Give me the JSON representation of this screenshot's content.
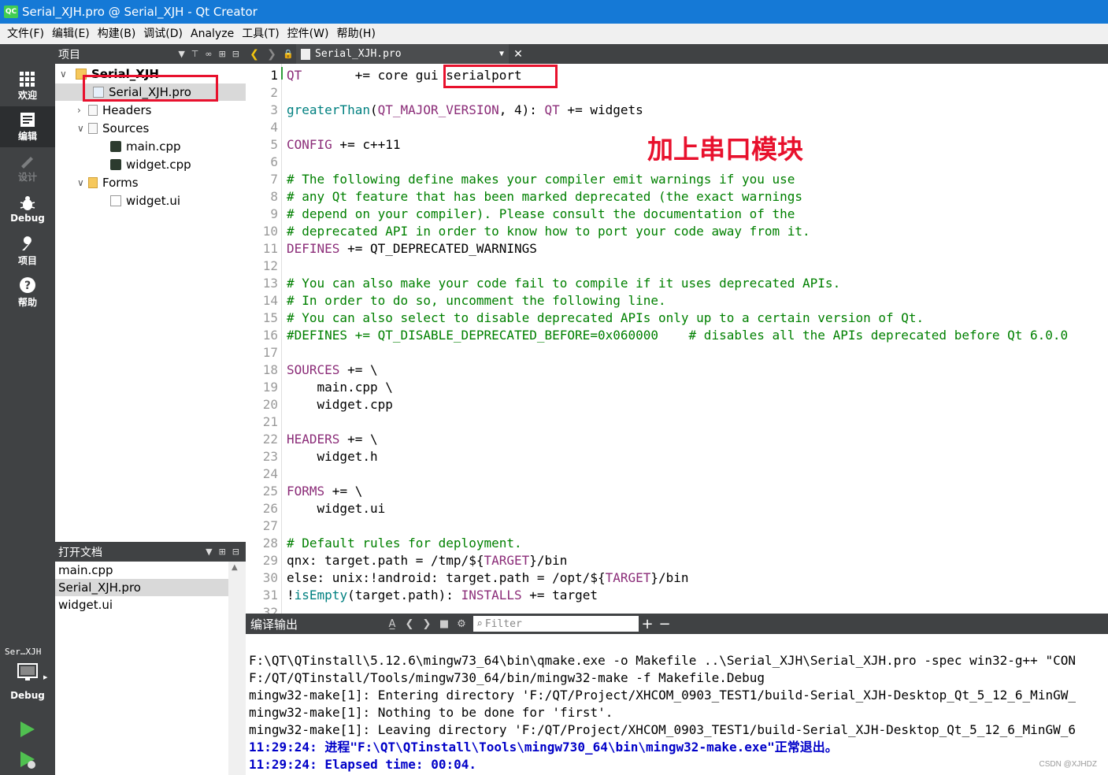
{
  "window": {
    "title": "Serial_XJH.pro @ Serial_XJH - Qt Creator",
    "logo_text": "QC"
  },
  "menubar": [
    "文件(F)",
    "编辑(E)",
    "构建(B)",
    "调试(D)",
    "Analyze",
    "工具(T)",
    "控件(W)",
    "帮助(H)"
  ],
  "modes": [
    {
      "label": "欢迎",
      "icon": "grid-icon",
      "state": "normal"
    },
    {
      "label": "编辑",
      "icon": "edit-icon",
      "state": "active"
    },
    {
      "label": "设计",
      "icon": "pen-icon",
      "state": "disabled"
    },
    {
      "label": "Debug",
      "icon": "bug-icon",
      "state": "normal"
    },
    {
      "label": "项目",
      "icon": "wrench-icon",
      "state": "normal"
    },
    {
      "label": "帮助",
      "icon": "help-icon",
      "state": "normal"
    }
  ],
  "kit": {
    "project": "Ser…XJH",
    "mode": "Debug"
  },
  "project_panel": {
    "title": "项目",
    "tree": [
      {
        "label": "Serial_XJH",
        "type": "project",
        "expanded": true
      },
      {
        "label": "Serial_XJH.pro",
        "type": "pro",
        "selected": true
      },
      {
        "label": "Headers",
        "type": "folder",
        "expanded": false
      },
      {
        "label": "Sources",
        "type": "folder",
        "expanded": true
      },
      {
        "label": "main.cpp",
        "type": "cpp"
      },
      {
        "label": "widget.cpp",
        "type": "cpp"
      },
      {
        "label": "Forms",
        "type": "folder",
        "expanded": true
      },
      {
        "label": "widget.ui",
        "type": "ui"
      }
    ]
  },
  "open_documents": {
    "title": "打开文档",
    "items": [
      {
        "label": "main.cpp",
        "selected": false
      },
      {
        "label": "Serial_XJH.pro",
        "selected": true
      },
      {
        "label": "widget.ui",
        "selected": false
      }
    ]
  },
  "editor": {
    "file_name": "Serial_XJH.pro",
    "current_line": 1,
    "annotation": "加上串口模块",
    "lines": [
      "QT       += core gui serialport",
      "",
      "greaterThan(QT_MAJOR_VERSION, 4): QT += widgets",
      "",
      "CONFIG += c++11",
      "",
      "# The following define makes your compiler emit warnings if you use",
      "# any Qt feature that has been marked deprecated (the exact warnings",
      "# depend on your compiler). Please consult the documentation of the",
      "# deprecated API in order to know how to port your code away from it.",
      "DEFINES += QT_DEPRECATED_WARNINGS",
      "",
      "# You can also make your code fail to compile if it uses deprecated APIs.",
      "# In order to do so, uncomment the following line.",
      "# You can also select to disable deprecated APIs only up to a certain version of Qt.",
      "#DEFINES += QT_DISABLE_DEPRECATED_BEFORE=0x060000    # disables all the APIs deprecated before Qt 6.0.0",
      "",
      "SOURCES += \\",
      "    main.cpp \\",
      "    widget.cpp",
      "",
      "HEADERS += \\",
      "    widget.h",
      "",
      "FORMS += \\",
      "    widget.ui",
      "",
      "# Default rules for deployment.",
      "qnx: target.path = /tmp/$${TARGET}/bin",
      "else: unix:!android: target.path = /opt/$${TARGET}/bin",
      "!isEmpty(target.path): INSTALLS += target",
      ""
    ],
    "line_numbers": [
      "1",
      "2",
      "3",
      "4",
      "5",
      "6",
      "7",
      "8",
      "9",
      "10",
      "11",
      "12",
      "13",
      "14",
      "15",
      "16",
      "17",
      "18",
      "19",
      "20",
      "21",
      "22",
      "23",
      "24",
      "25",
      "26",
      "27",
      "28",
      "29",
      "30",
      "31",
      "32"
    ]
  },
  "output": {
    "title": "编译输出",
    "filter_placeholder": "Filter",
    "lines": [
      {
        "text": "",
        "style": "normal"
      },
      {
        "text": "F:\\QT\\QTinstall\\5.12.6\\mingw73_64\\bin\\qmake.exe -o Makefile ..\\Serial_XJH\\Serial_XJH.pro -spec win32-g++ \"CON",
        "style": "normal"
      },
      {
        "text": "F:/QT/QTinstall/Tools/mingw730_64/bin/mingw32-make -f Makefile.Debug",
        "style": "normal"
      },
      {
        "text": "mingw32-make[1]: Entering directory 'F:/QT/Project/XHCOM_0903_TEST1/build-Serial_XJH-Desktop_Qt_5_12_6_MinGW_",
        "style": "normal"
      },
      {
        "text": "mingw32-make[1]: Nothing to be done for 'first'.",
        "style": "normal"
      },
      {
        "text": "mingw32-make[1]: Leaving directory 'F:/QT/Project/XHCOM_0903_TEST1/build-Serial_XJH-Desktop_Qt_5_12_6_MinGW_6",
        "style": "normal"
      },
      {
        "text": "11:29:24: 进程\"F:\\QT\\QTinstall\\Tools\\mingw730_64\\bin\\mingw32-make.exe\"正常退出。",
        "style": "blue"
      },
      {
        "text": "11:29:24: Elapsed time: 00:04.",
        "style": "blue"
      }
    ]
  },
  "watermark": "CSDN @XJHDZ",
  "colors": {
    "highlight": "#e8112d",
    "titlebar": "#1579d6",
    "sidebar": "#404244"
  }
}
